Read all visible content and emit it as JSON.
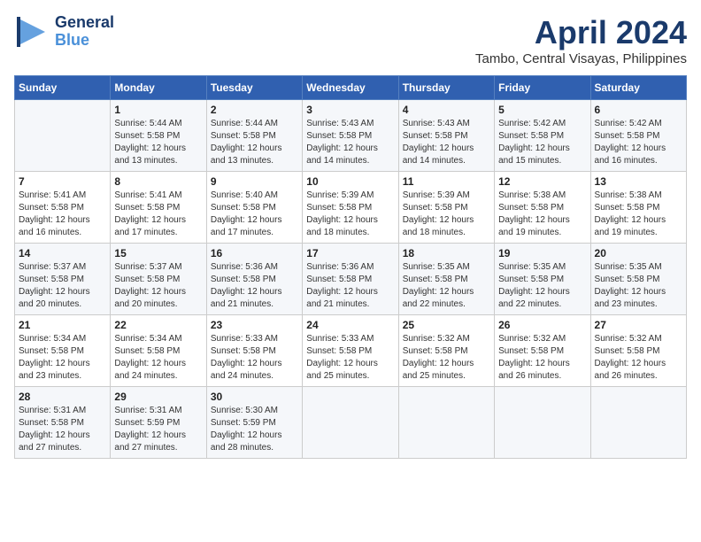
{
  "header": {
    "logo_general": "General",
    "logo_blue": "Blue",
    "month_year": "April 2024",
    "location": "Tambo, Central Visayas, Philippines"
  },
  "columns": [
    "Sunday",
    "Monday",
    "Tuesday",
    "Wednesday",
    "Thursday",
    "Friday",
    "Saturday"
  ],
  "weeks": [
    [
      {
        "day": "",
        "info": ""
      },
      {
        "day": "1",
        "info": "Sunrise: 5:44 AM\nSunset: 5:58 PM\nDaylight: 12 hours\nand 13 minutes."
      },
      {
        "day": "2",
        "info": "Sunrise: 5:44 AM\nSunset: 5:58 PM\nDaylight: 12 hours\nand 13 minutes."
      },
      {
        "day": "3",
        "info": "Sunrise: 5:43 AM\nSunset: 5:58 PM\nDaylight: 12 hours\nand 14 minutes."
      },
      {
        "day": "4",
        "info": "Sunrise: 5:43 AM\nSunset: 5:58 PM\nDaylight: 12 hours\nand 14 minutes."
      },
      {
        "day": "5",
        "info": "Sunrise: 5:42 AM\nSunset: 5:58 PM\nDaylight: 12 hours\nand 15 minutes."
      },
      {
        "day": "6",
        "info": "Sunrise: 5:42 AM\nSunset: 5:58 PM\nDaylight: 12 hours\nand 16 minutes."
      }
    ],
    [
      {
        "day": "7",
        "info": "Sunrise: 5:41 AM\nSunset: 5:58 PM\nDaylight: 12 hours\nand 16 minutes."
      },
      {
        "day": "8",
        "info": "Sunrise: 5:41 AM\nSunset: 5:58 PM\nDaylight: 12 hours\nand 17 minutes."
      },
      {
        "day": "9",
        "info": "Sunrise: 5:40 AM\nSunset: 5:58 PM\nDaylight: 12 hours\nand 17 minutes."
      },
      {
        "day": "10",
        "info": "Sunrise: 5:39 AM\nSunset: 5:58 PM\nDaylight: 12 hours\nand 18 minutes."
      },
      {
        "day": "11",
        "info": "Sunrise: 5:39 AM\nSunset: 5:58 PM\nDaylight: 12 hours\nand 18 minutes."
      },
      {
        "day": "12",
        "info": "Sunrise: 5:38 AM\nSunset: 5:58 PM\nDaylight: 12 hours\nand 19 minutes."
      },
      {
        "day": "13",
        "info": "Sunrise: 5:38 AM\nSunset: 5:58 PM\nDaylight: 12 hours\nand 19 minutes."
      }
    ],
    [
      {
        "day": "14",
        "info": "Sunrise: 5:37 AM\nSunset: 5:58 PM\nDaylight: 12 hours\nand 20 minutes."
      },
      {
        "day": "15",
        "info": "Sunrise: 5:37 AM\nSunset: 5:58 PM\nDaylight: 12 hours\nand 20 minutes."
      },
      {
        "day": "16",
        "info": "Sunrise: 5:36 AM\nSunset: 5:58 PM\nDaylight: 12 hours\nand 21 minutes."
      },
      {
        "day": "17",
        "info": "Sunrise: 5:36 AM\nSunset: 5:58 PM\nDaylight: 12 hours\nand 21 minutes."
      },
      {
        "day": "18",
        "info": "Sunrise: 5:35 AM\nSunset: 5:58 PM\nDaylight: 12 hours\nand 22 minutes."
      },
      {
        "day": "19",
        "info": "Sunrise: 5:35 AM\nSunset: 5:58 PM\nDaylight: 12 hours\nand 22 minutes."
      },
      {
        "day": "20",
        "info": "Sunrise: 5:35 AM\nSunset: 5:58 PM\nDaylight: 12 hours\nand 23 minutes."
      }
    ],
    [
      {
        "day": "21",
        "info": "Sunrise: 5:34 AM\nSunset: 5:58 PM\nDaylight: 12 hours\nand 23 minutes."
      },
      {
        "day": "22",
        "info": "Sunrise: 5:34 AM\nSunset: 5:58 PM\nDaylight: 12 hours\nand 24 minutes."
      },
      {
        "day": "23",
        "info": "Sunrise: 5:33 AM\nSunset: 5:58 PM\nDaylight: 12 hours\nand 24 minutes."
      },
      {
        "day": "24",
        "info": "Sunrise: 5:33 AM\nSunset: 5:58 PM\nDaylight: 12 hours\nand 25 minutes."
      },
      {
        "day": "25",
        "info": "Sunrise: 5:32 AM\nSunset: 5:58 PM\nDaylight: 12 hours\nand 25 minutes."
      },
      {
        "day": "26",
        "info": "Sunrise: 5:32 AM\nSunset: 5:58 PM\nDaylight: 12 hours\nand 26 minutes."
      },
      {
        "day": "27",
        "info": "Sunrise: 5:32 AM\nSunset: 5:58 PM\nDaylight: 12 hours\nand 26 minutes."
      }
    ],
    [
      {
        "day": "28",
        "info": "Sunrise: 5:31 AM\nSunset: 5:58 PM\nDaylight: 12 hours\nand 27 minutes."
      },
      {
        "day": "29",
        "info": "Sunrise: 5:31 AM\nSunset: 5:59 PM\nDaylight: 12 hours\nand 27 minutes."
      },
      {
        "day": "30",
        "info": "Sunrise: 5:30 AM\nSunset: 5:59 PM\nDaylight: 12 hours\nand 28 minutes."
      },
      {
        "day": "",
        "info": ""
      },
      {
        "day": "",
        "info": ""
      },
      {
        "day": "",
        "info": ""
      },
      {
        "day": "",
        "info": ""
      }
    ]
  ]
}
